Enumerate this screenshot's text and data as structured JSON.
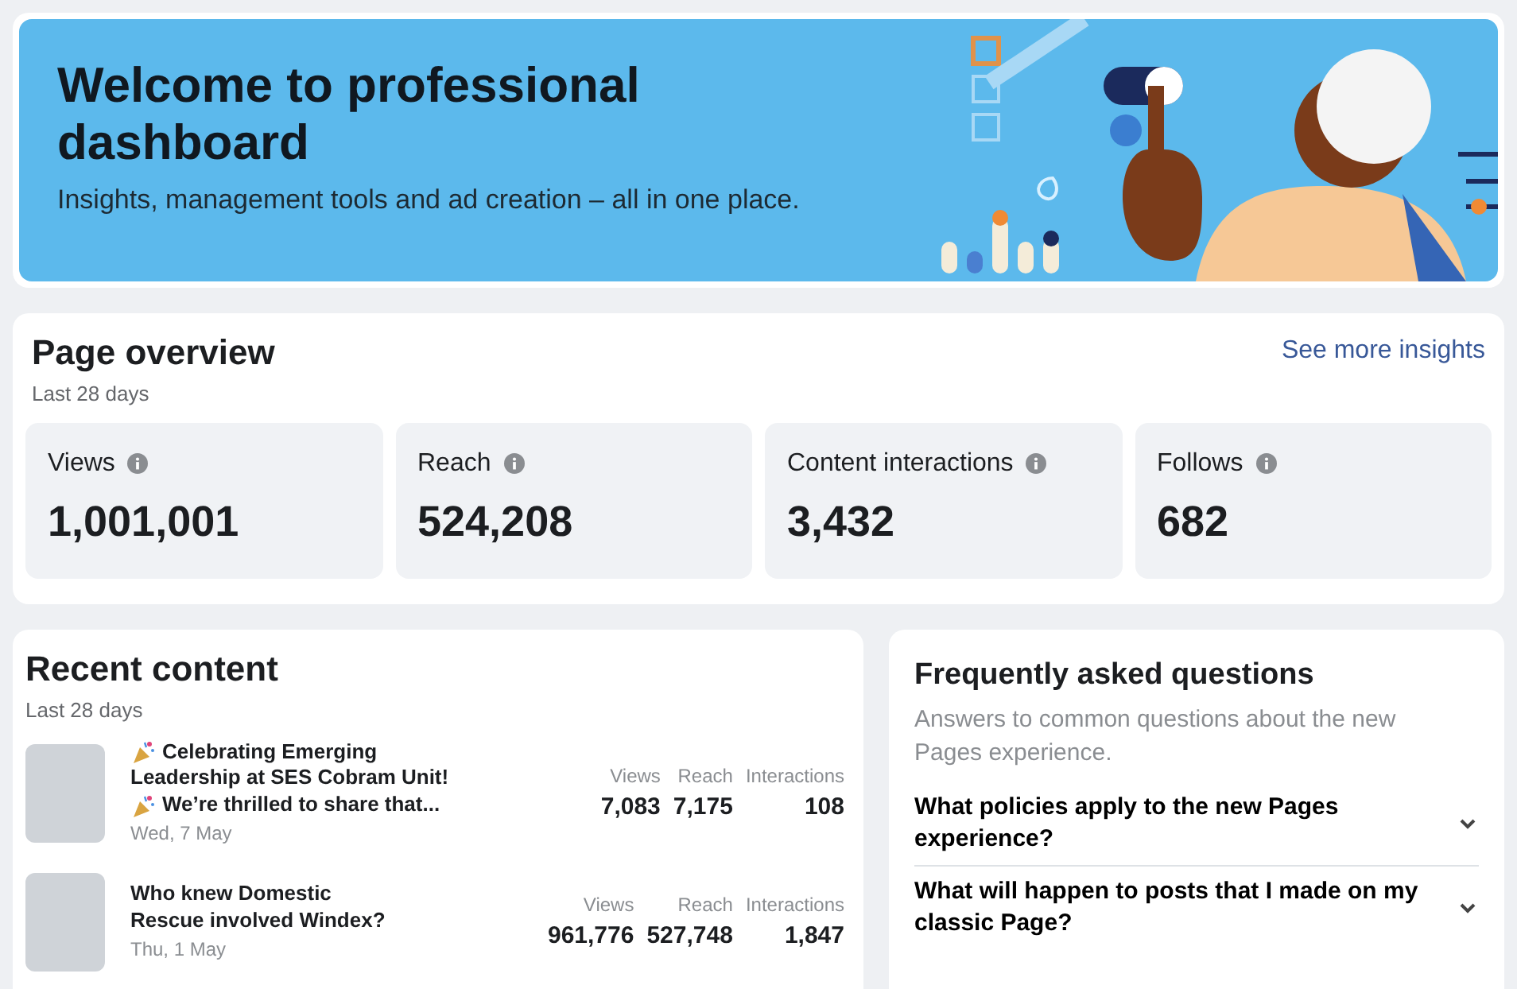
{
  "banner": {
    "title": "Welcome to professional dashboard",
    "subtitle": "Insights, management tools and ad creation – all in one place."
  },
  "overview": {
    "title": "Page overview",
    "period": "Last 28 days",
    "link": "See more insights",
    "metrics": [
      {
        "label": "Views",
        "value": "1,001,001"
      },
      {
        "label": "Reach",
        "value": "524,208"
      },
      {
        "label": "Content interactions",
        "value": "3,432"
      },
      {
        "label": "Follows",
        "value": "682"
      }
    ]
  },
  "recent": {
    "title": "Recent content",
    "period": "Last 28 days",
    "posts": [
      {
        "lines": [
          {
            "text": "Celebrating Emerging",
            "emoji": true
          },
          {
            "text": "Leadership at SES Cobram Unit!",
            "emoji": false
          },
          {
            "text": "We’re thrilled to share that...",
            "emoji": true
          }
        ],
        "date": "Wed, 7 May",
        "stats": [
          {
            "label": "Views",
            "value": "7,083"
          },
          {
            "label": "Reach",
            "value": "7,175"
          },
          {
            "label": "Interactions",
            "value": "108"
          }
        ]
      },
      {
        "lines": [
          {
            "text": "Who knew Domestic",
            "emoji": false
          },
          {
            "text": "Rescue involved Windex?",
            "emoji": false
          }
        ],
        "date": "Thu, 1 May",
        "stats": [
          {
            "label": "Views",
            "value": "961,776"
          },
          {
            "label": "Reach",
            "value": "527,748"
          },
          {
            "label": "Interactions",
            "value": "1,847"
          }
        ]
      }
    ]
  },
  "faq": {
    "title": "Frequently asked questions",
    "subtitle": "Answers to common questions about the new Pages experience.",
    "items": [
      {
        "question": "What policies apply to the new Pages experience?",
        "expanded": false
      },
      {
        "question": "What will happen to posts that I made on my classic Page?",
        "expanded": false
      }
    ]
  }
}
